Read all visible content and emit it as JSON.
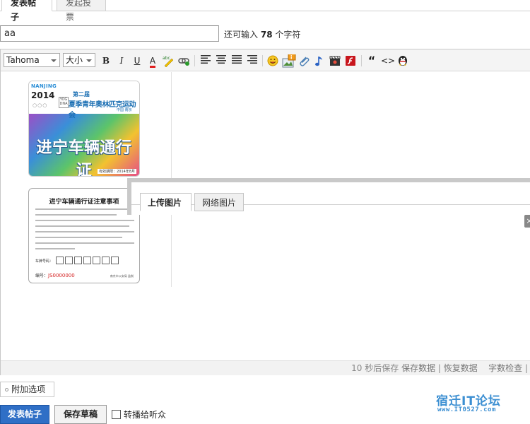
{
  "tabs": [
    {
      "label": "发表帖子",
      "active": true
    },
    {
      "label": "发起投票",
      "active": false
    }
  ],
  "title_field": {
    "value": "aa",
    "hint_prefix": "还可输入",
    "hint_count": "78",
    "hint_suffix": "个字符"
  },
  "toolbar": {
    "font_family": "Tahoma",
    "font_size": "大小",
    "bold": "B",
    "italic": "I",
    "underline": "U",
    "font_color": "A",
    "spell": "abc",
    "quote": "“",
    "code": "<>"
  },
  "card1": {
    "logo_city": "NANJING",
    "logo_year": "2014",
    "logo_rings": "○○○",
    "yog": "YOG DNA",
    "heading_small": "第二届",
    "heading_main": "夏季青年奥林匹克运动会",
    "heading_city": "中国·南京",
    "main_text": "进宁车辆通行证",
    "validity": "有效期限：2014年8月"
  },
  "card2": {
    "title": "进宁车辆通行证注意事项",
    "plate_label": "车牌号码：",
    "number_label": "编号：",
    "number_value": "JS0000000",
    "issuer": "南京市公安局 监制"
  },
  "upload_dialog": {
    "tabs": [
      {
        "label": "上传图片",
        "active": true
      },
      {
        "label": "网络图片",
        "active": false
      }
    ],
    "close": "×"
  },
  "status_bar": {
    "autosave": "10 秒后保存",
    "save_data": "保存数据",
    "restore_data": "恢复数据",
    "word_check": "字数检查"
  },
  "bottom": {
    "extra_options": "附加选项",
    "post_button": "发表帖子",
    "draft_button": "保存草稿",
    "forward_label": "转播给听众"
  },
  "watermark": {
    "name": "宿迁IT论坛",
    "url": "www.IT0527.com"
  }
}
